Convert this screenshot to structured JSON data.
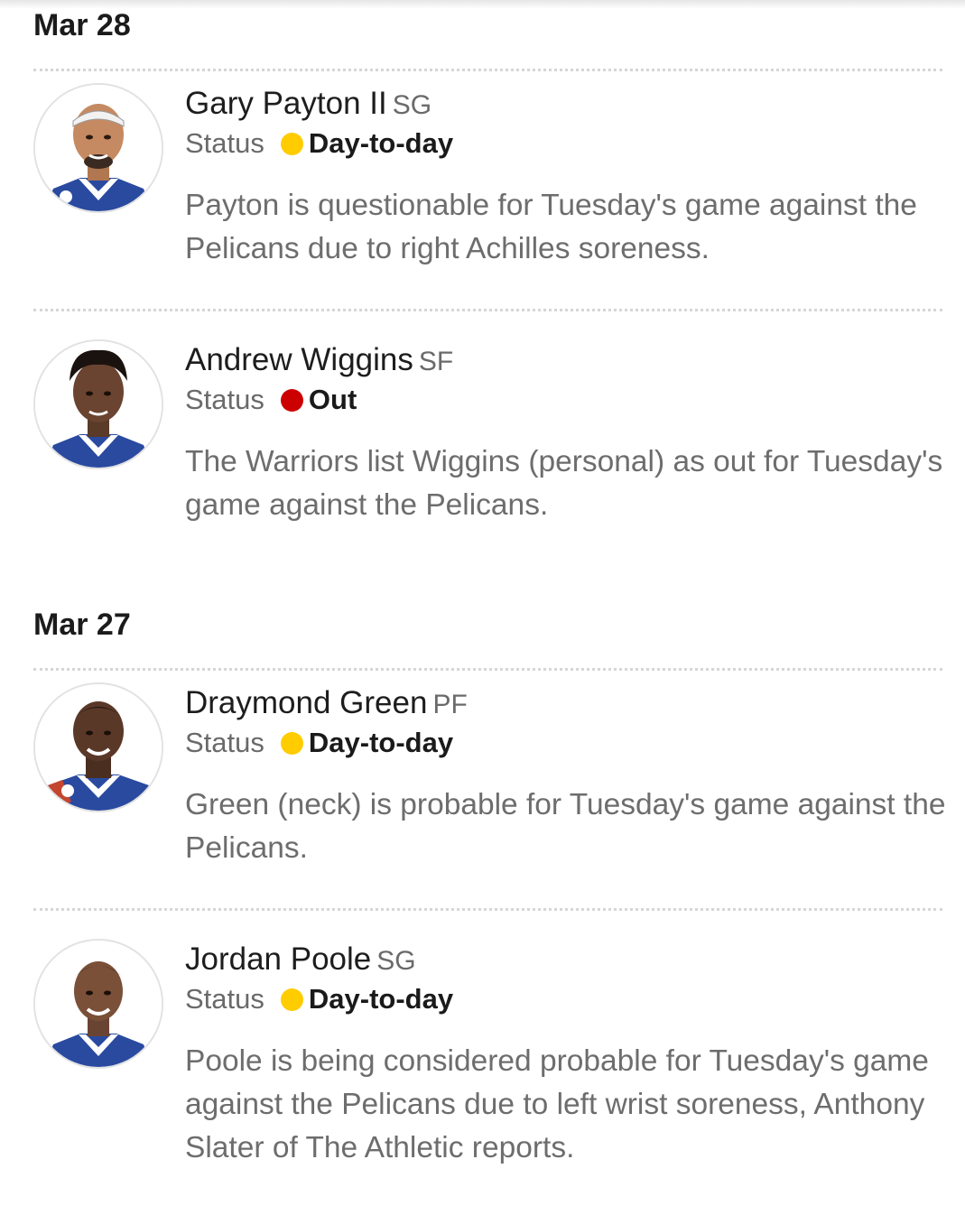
{
  "sections": [
    {
      "date": "Mar 28",
      "entries": [
        {
          "name": "Gary Payton II",
          "position": "SG",
          "status_label": "Status",
          "status": "Day-to-day",
          "status_color": "#ffcc00",
          "note": "Payton is questionable for Tuesday's game against the Pelicans due to right Achilles soreness."
        },
        {
          "name": "Andrew Wiggins",
          "position": "SF",
          "status_label": "Status",
          "status": "Out",
          "status_color": "#cc0000",
          "note": "The Warriors list Wiggins (personal) as out for Tuesday's game against the Pelicans."
        }
      ]
    },
    {
      "date": "Mar 27",
      "entries": [
        {
          "name": "Draymond Green",
          "position": "PF",
          "status_label": "Status",
          "status": "Day-to-day",
          "status_color": "#ffcc00",
          "note": "Green (neck) is probable for Tuesday's game against the Pelicans."
        },
        {
          "name": "Jordan Poole",
          "position": "SG",
          "status_label": "Status",
          "status": "Day-to-day",
          "status_color": "#ffcc00",
          "note": "Poole is being considered probable for Tuesday's game against the Pelicans due to left wrist soreness, Anthony Slater of The Athletic reports."
        }
      ]
    }
  ]
}
